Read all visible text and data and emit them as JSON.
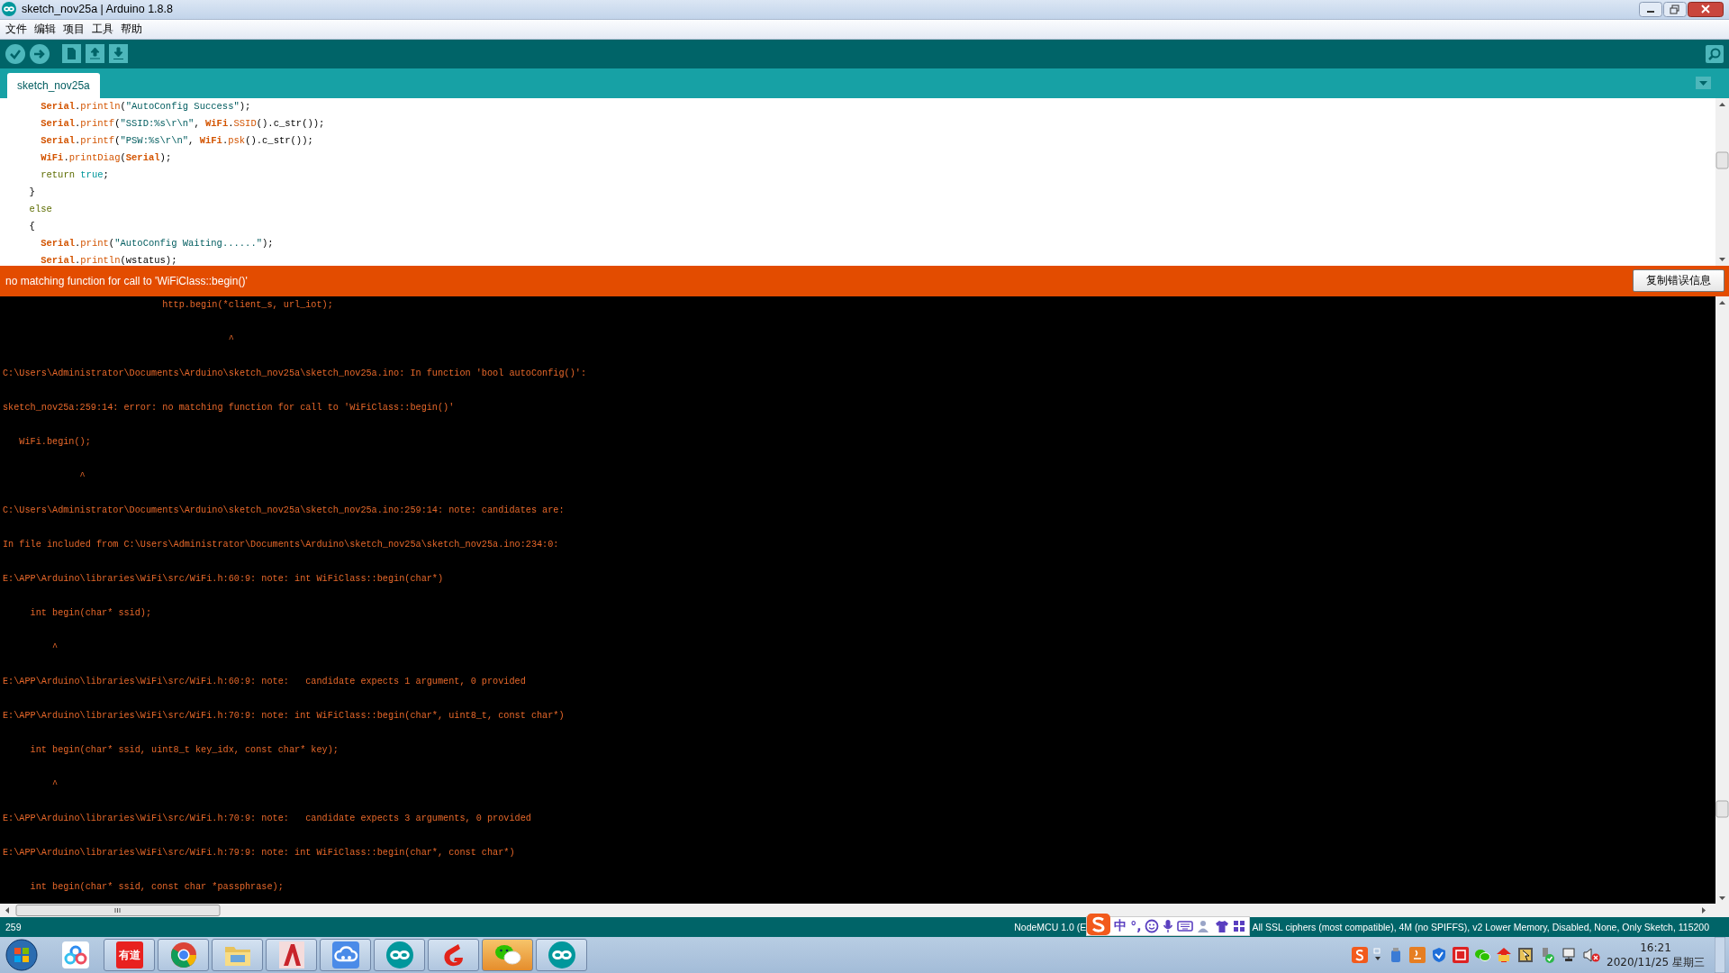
{
  "window": {
    "title": "sketch_nov25a | Arduino 1.8.8"
  },
  "menu": [
    "文件",
    "编辑",
    "项目",
    "工具",
    "帮助"
  ],
  "tabs": [
    {
      "label": "sketch_nov25a",
      "selected": true
    }
  ],
  "editor": {
    "lines": [
      [
        {
          "text": "    Serial",
          "kind": "object"
        },
        {
          "text": ".",
          "kind": "plain"
        },
        {
          "text": "println",
          "kind": "function"
        },
        {
          "text": "(",
          "kind": "plain"
        },
        {
          "text": "\"AutoConfig Success\"",
          "kind": "string"
        },
        {
          "text": ");",
          "kind": "plain"
        }
      ],
      [
        {
          "text": "    Serial",
          "kind": "object"
        },
        {
          "text": ".",
          "kind": "plain"
        },
        {
          "text": "printf",
          "kind": "function"
        },
        {
          "text": "(",
          "kind": "plain"
        },
        {
          "text": "\"SSID:%s\\r\\n\"",
          "kind": "string"
        },
        {
          "text": ", ",
          "kind": "plain"
        },
        {
          "text": "WiFi",
          "kind": "object"
        },
        {
          "text": ".",
          "kind": "plain"
        },
        {
          "text": "SSID",
          "kind": "function"
        },
        {
          "text": "().c_str());",
          "kind": "plain"
        }
      ],
      [
        {
          "text": "    Serial",
          "kind": "object"
        },
        {
          "text": ".",
          "kind": "plain"
        },
        {
          "text": "printf",
          "kind": "function"
        },
        {
          "text": "(",
          "kind": "plain"
        },
        {
          "text": "\"PSW:%s\\r\\n\"",
          "kind": "string"
        },
        {
          "text": ", ",
          "kind": "plain"
        },
        {
          "text": "WiFi",
          "kind": "object"
        },
        {
          "text": ".",
          "kind": "plain"
        },
        {
          "text": "psk",
          "kind": "function"
        },
        {
          "text": "().c_str());",
          "kind": "plain"
        }
      ],
      [
        {
          "text": "    WiFi",
          "kind": "object"
        },
        {
          "text": ".",
          "kind": "plain"
        },
        {
          "text": "printDiag",
          "kind": "function"
        },
        {
          "text": "(",
          "kind": "plain"
        },
        {
          "text": "Serial",
          "kind": "object"
        },
        {
          "text": ");",
          "kind": "plain"
        }
      ],
      [
        {
          "text": "    return ",
          "kind": "keyword"
        },
        {
          "text": "true",
          "kind": "literal"
        },
        {
          "text": ";",
          "kind": "plain"
        }
      ],
      [
        {
          "text": "  }",
          "kind": "plain"
        }
      ],
      [
        {
          "text": "  else",
          "kind": "keyword"
        }
      ],
      [
        {
          "text": "  {",
          "kind": "plain"
        }
      ],
      [
        {
          "text": "    Serial",
          "kind": "object"
        },
        {
          "text": ".",
          "kind": "plain"
        },
        {
          "text": "print",
          "kind": "function"
        },
        {
          "text": "(",
          "kind": "plain"
        },
        {
          "text": "\"AutoConfig Waiting......\"",
          "kind": "string"
        },
        {
          "text": ");",
          "kind": "plain"
        }
      ],
      [
        {
          "text": "    Serial",
          "kind": "object"
        },
        {
          "text": ".",
          "kind": "plain"
        },
        {
          "text": "println",
          "kind": "function"
        },
        {
          "text": "(wstatus);",
          "kind": "plain"
        }
      ]
    ]
  },
  "error_bar": {
    "message": "no matching function for call to 'WiFiClass::begin()'",
    "button": "复制错误信息"
  },
  "console": {
    "lines": [
      "                             http.begin(*client_s, url_iot);",
      "                                         ^",
      "C:\\Users\\Administrator\\Documents\\Arduino\\sketch_nov25a\\sketch_nov25a.ino: In function 'bool autoConfig()':",
      "sketch_nov25a:259:14: error: no matching function for call to 'WiFiClass::begin()'",
      "   WiFi.begin();",
      "              ^",
      "C:\\Users\\Administrator\\Documents\\Arduino\\sketch_nov25a\\sketch_nov25a.ino:259:14: note: candidates are:",
      "In file included from C:\\Users\\Administrator\\Documents\\Arduino\\sketch_nov25a\\sketch_nov25a.ino:234:0:",
      "E:\\APP\\Arduino\\libraries\\WiFi\\src/WiFi.h:60:9: note: int WiFiClass::begin(char*)",
      "     int begin(char* ssid);",
      "         ^",
      "E:\\APP\\Arduino\\libraries\\WiFi\\src/WiFi.h:60:9: note:   candidate expects 1 argument, 0 provided",
      "E:\\APP\\Arduino\\libraries\\WiFi\\src/WiFi.h:70:9: note: int WiFiClass::begin(char*, uint8_t, const char*)",
      "     int begin(char* ssid, uint8_t key_idx, const char* key);",
      "         ^",
      "E:\\APP\\Arduino\\libraries\\WiFi\\src/WiFi.h:70:9: note:   candidate expects 3 arguments, 0 provided",
      "E:\\APP\\Arduino\\libraries\\WiFi\\src/WiFi.h:79:9: note: int WiFiClass::begin(char*, const char*)",
      "     int begin(char* ssid, const char *passphrase);"
    ]
  },
  "status_bar": {
    "line": "259",
    "board_start": "NodeMCU 1.0 (E",
    "board_rest": "All SSL ciphers (most compatible), 4M (no SPIFFS), v2 Lower Memory, Disabled, None, Only Sketch, 115200",
    "ime": {
      "mode": "中",
      "punct": "°,"
    }
  },
  "taskbar": {
    "apps": [
      {
        "kind": "cloud",
        "open": false,
        "highlighted": false
      },
      {
        "kind": "dictionary",
        "label": "有道",
        "open": true,
        "highlighted": false
      },
      {
        "kind": "browser",
        "open": true,
        "highlighted": false
      },
      {
        "kind": "folder",
        "open": true,
        "highlighted": false
      },
      {
        "kind": "cad",
        "open": true,
        "highlighted": false
      },
      {
        "kind": "cloud-sync",
        "open": true,
        "highlighted": false
      },
      {
        "kind": "arduino",
        "open": true,
        "highlighted": false
      },
      {
        "kind": "flame",
        "open": true,
        "highlighted": false
      },
      {
        "kind": "chat",
        "open": true,
        "highlighted": true
      },
      {
        "kind": "arduino",
        "open": true,
        "highlighted": false
      }
    ],
    "time": "16:21",
    "date": "2020/11/25 星期三"
  }
}
